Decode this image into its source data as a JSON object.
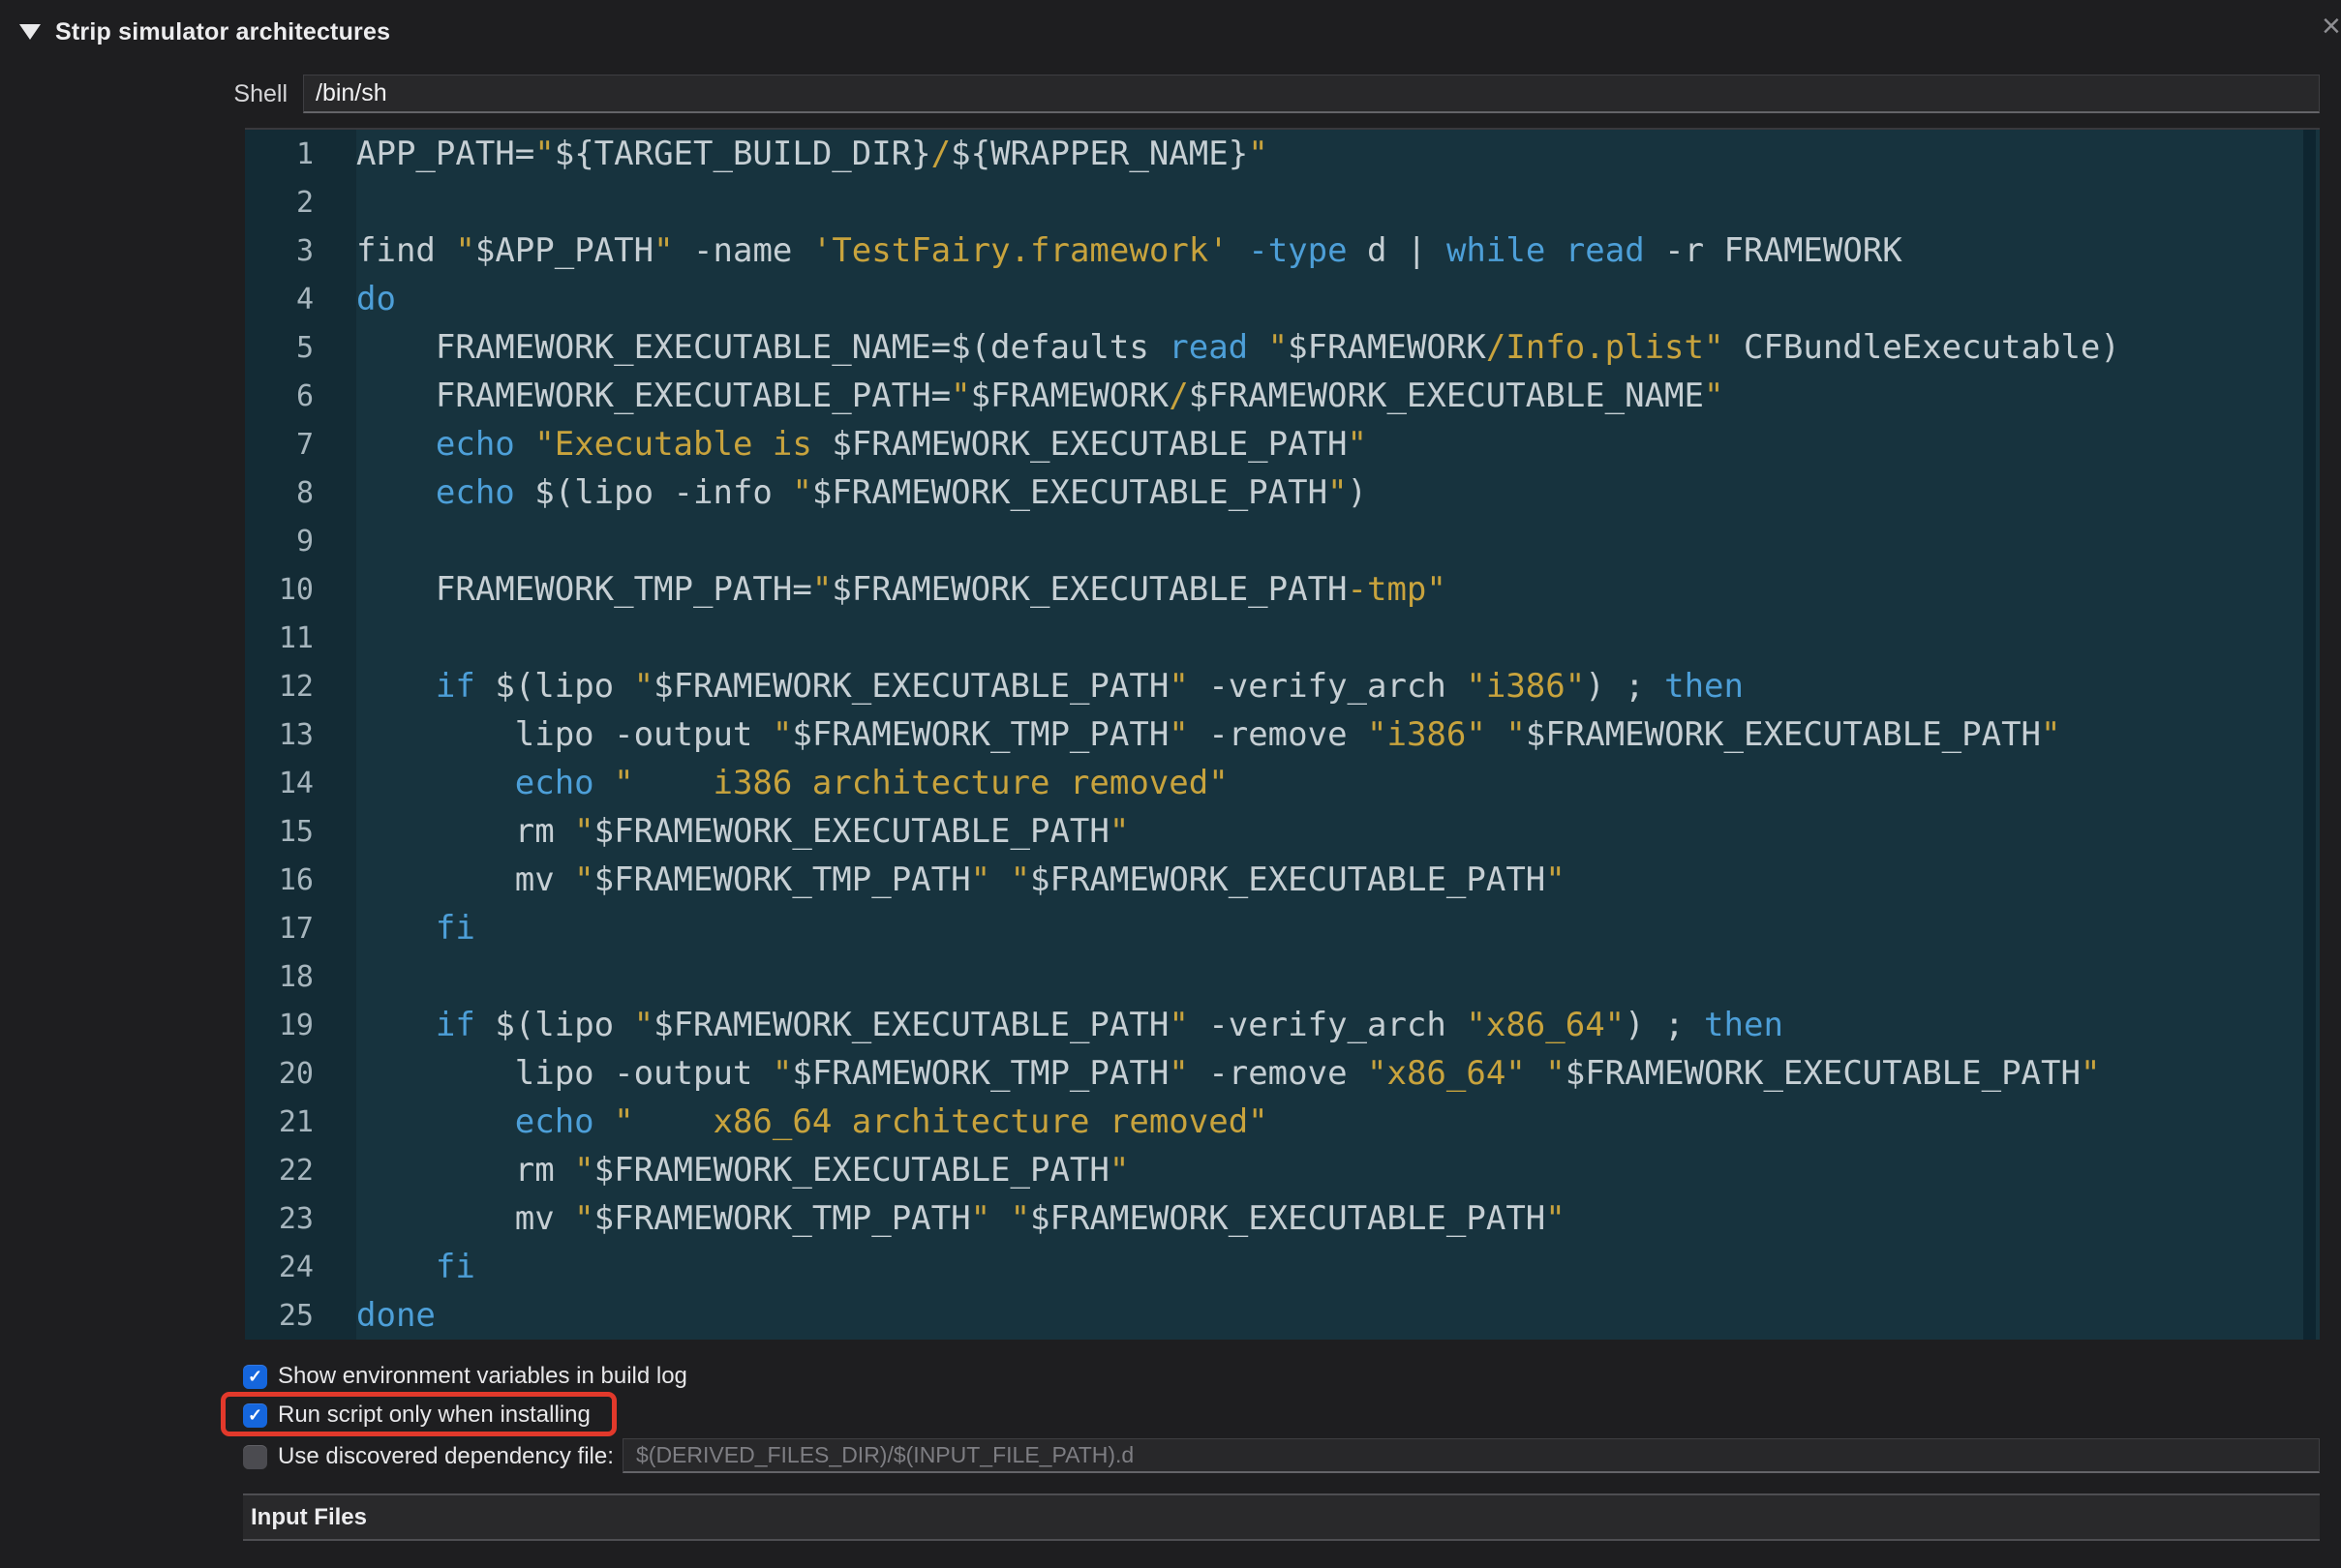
{
  "header": {
    "title": "Strip simulator architectures",
    "disclosure_state": "expanded",
    "close_glyph": "×"
  },
  "shell": {
    "label": "Shell",
    "value": "/bin/sh"
  },
  "editor": {
    "language": "shell-script",
    "line_count": 25,
    "lines": [
      {
        "n": 1,
        "tokens": [
          [
            "p",
            "APP_PATH="
          ],
          [
            "o",
            "\""
          ],
          [
            "p",
            "${TARGET_BUILD_DIR}"
          ],
          [
            "o",
            "/"
          ],
          [
            "p",
            "${WRAPPER_NAME}"
          ],
          [
            "o",
            "\""
          ]
        ]
      },
      {
        "n": 2,
        "tokens": []
      },
      {
        "n": 3,
        "tokens": [
          [
            "p",
            "find "
          ],
          [
            "o",
            "\""
          ],
          [
            "p",
            "$APP_PATH"
          ],
          [
            "o",
            "\""
          ],
          [
            "p",
            " -name "
          ],
          [
            "o",
            "'TestFairy.framework'"
          ],
          [
            "p",
            " "
          ],
          [
            "b",
            "-type"
          ],
          [
            "p",
            " d | "
          ],
          [
            "b",
            "while"
          ],
          [
            "p",
            " "
          ],
          [
            "b",
            "read"
          ],
          [
            "p",
            " -r FRAMEWORK"
          ]
        ]
      },
      {
        "n": 4,
        "tokens": [
          [
            "b",
            "do"
          ]
        ]
      },
      {
        "n": 5,
        "tokens": [
          [
            "p",
            "    FRAMEWORK_EXECUTABLE_NAME=$(defaults "
          ],
          [
            "b",
            "read"
          ],
          [
            "p",
            " "
          ],
          [
            "o",
            "\""
          ],
          [
            "p",
            "$FRAMEWORK"
          ],
          [
            "o",
            "/Info.plist\""
          ],
          [
            "p",
            " CFBundleExecutable)"
          ]
        ]
      },
      {
        "n": 6,
        "tokens": [
          [
            "p",
            "    FRAMEWORK_EXECUTABLE_PATH="
          ],
          [
            "o",
            "\""
          ],
          [
            "p",
            "$FRAMEWORK"
          ],
          [
            "o",
            "/"
          ],
          [
            "p",
            "$FRAMEWORK_EXECUTABLE_NAME"
          ],
          [
            "o",
            "\""
          ]
        ]
      },
      {
        "n": 7,
        "tokens": [
          [
            "p",
            "    "
          ],
          [
            "b",
            "echo"
          ],
          [
            "p",
            " "
          ],
          [
            "o",
            "\"Executable is "
          ],
          [
            "p",
            "$FRAMEWORK_EXECUTABLE_PATH"
          ],
          [
            "o",
            "\""
          ]
        ]
      },
      {
        "n": 8,
        "tokens": [
          [
            "p",
            "    "
          ],
          [
            "b",
            "echo"
          ],
          [
            "p",
            " $(lipo -info "
          ],
          [
            "o",
            "\""
          ],
          [
            "p",
            "$FRAMEWORK_EXECUTABLE_PATH"
          ],
          [
            "o",
            "\""
          ],
          [
            "p",
            ")"
          ]
        ]
      },
      {
        "n": 9,
        "tokens": []
      },
      {
        "n": 10,
        "tokens": [
          [
            "p",
            "    FRAMEWORK_TMP_PATH="
          ],
          [
            "o",
            "\""
          ],
          [
            "p",
            "$FRAMEWORK_EXECUTABLE_PATH"
          ],
          [
            "o",
            "-tmp\""
          ]
        ]
      },
      {
        "n": 11,
        "tokens": []
      },
      {
        "n": 12,
        "tokens": [
          [
            "p",
            "    "
          ],
          [
            "b",
            "if"
          ],
          [
            "p",
            " $(lipo "
          ],
          [
            "o",
            "\""
          ],
          [
            "p",
            "$FRAMEWORK_EXECUTABLE_PATH"
          ],
          [
            "o",
            "\""
          ],
          [
            "p",
            " -verify_arch "
          ],
          [
            "o",
            "\"i386\""
          ],
          [
            "p",
            ") ; "
          ],
          [
            "b",
            "then"
          ]
        ]
      },
      {
        "n": 13,
        "tokens": [
          [
            "p",
            "        lipo -output "
          ],
          [
            "o",
            "\""
          ],
          [
            "p",
            "$FRAMEWORK_TMP_PATH"
          ],
          [
            "o",
            "\""
          ],
          [
            "p",
            " -remove "
          ],
          [
            "o",
            "\"i386\""
          ],
          [
            "p",
            " "
          ],
          [
            "o",
            "\""
          ],
          [
            "p",
            "$FRAMEWORK_EXECUTABLE_PATH"
          ],
          [
            "o",
            "\""
          ]
        ]
      },
      {
        "n": 14,
        "tokens": [
          [
            "p",
            "        "
          ],
          [
            "b",
            "echo"
          ],
          [
            "p",
            " "
          ],
          [
            "o",
            "\"    i386 architecture removed\""
          ]
        ]
      },
      {
        "n": 15,
        "tokens": [
          [
            "p",
            "        rm "
          ],
          [
            "o",
            "\""
          ],
          [
            "p",
            "$FRAMEWORK_EXECUTABLE_PATH"
          ],
          [
            "o",
            "\""
          ]
        ]
      },
      {
        "n": 16,
        "tokens": [
          [
            "p",
            "        mv "
          ],
          [
            "o",
            "\""
          ],
          [
            "p",
            "$FRAMEWORK_TMP_PATH"
          ],
          [
            "o",
            "\""
          ],
          [
            "p",
            " "
          ],
          [
            "o",
            "\""
          ],
          [
            "p",
            "$FRAMEWORK_EXECUTABLE_PATH"
          ],
          [
            "o",
            "\""
          ]
        ]
      },
      {
        "n": 17,
        "tokens": [
          [
            "p",
            "    "
          ],
          [
            "b",
            "fi"
          ]
        ]
      },
      {
        "n": 18,
        "tokens": []
      },
      {
        "n": 19,
        "tokens": [
          [
            "p",
            "    "
          ],
          [
            "b",
            "if"
          ],
          [
            "p",
            " $(lipo "
          ],
          [
            "o",
            "\""
          ],
          [
            "p",
            "$FRAMEWORK_EXECUTABLE_PATH"
          ],
          [
            "o",
            "\""
          ],
          [
            "p",
            " -verify_arch "
          ],
          [
            "o",
            "\"x86_64\""
          ],
          [
            "p",
            ") ; "
          ],
          [
            "b",
            "then"
          ]
        ]
      },
      {
        "n": 20,
        "tokens": [
          [
            "p",
            "        lipo -output "
          ],
          [
            "o",
            "\""
          ],
          [
            "p",
            "$FRAMEWORK_TMP_PATH"
          ],
          [
            "o",
            "\""
          ],
          [
            "p",
            " -remove "
          ],
          [
            "o",
            "\"x86_64\""
          ],
          [
            "p",
            " "
          ],
          [
            "o",
            "\""
          ],
          [
            "p",
            "$FRAMEWORK_EXECUTABLE_PATH"
          ],
          [
            "o",
            "\""
          ]
        ]
      },
      {
        "n": 21,
        "tokens": [
          [
            "p",
            "        "
          ],
          [
            "b",
            "echo"
          ],
          [
            "p",
            " "
          ],
          [
            "o",
            "\"    x86_64 architecture removed\""
          ]
        ]
      },
      {
        "n": 22,
        "tokens": [
          [
            "p",
            "        rm "
          ],
          [
            "o",
            "\""
          ],
          [
            "p",
            "$FRAMEWORK_EXECUTABLE_PATH"
          ],
          [
            "o",
            "\""
          ]
        ]
      },
      {
        "n": 23,
        "tokens": [
          [
            "p",
            "        mv "
          ],
          [
            "o",
            "\""
          ],
          [
            "p",
            "$FRAMEWORK_TMP_PATH"
          ],
          [
            "o",
            "\""
          ],
          [
            "p",
            " "
          ],
          [
            "o",
            "\""
          ],
          [
            "p",
            "$FRAMEWORK_EXECUTABLE_PATH"
          ],
          [
            "o",
            "\""
          ]
        ]
      },
      {
        "n": 24,
        "tokens": [
          [
            "p",
            "    "
          ],
          [
            "b",
            "fi"
          ]
        ]
      },
      {
        "n": 25,
        "tokens": [
          [
            "b",
            "done"
          ]
        ]
      }
    ]
  },
  "options": {
    "check_glyph": "✓",
    "items": [
      {
        "label": "Show environment variables in build log",
        "checked": true,
        "highlighted": false
      },
      {
        "label": "Run script only when installing",
        "checked": true,
        "highlighted": true
      },
      {
        "label": "Use discovered dependency file:",
        "checked": false,
        "highlighted": false,
        "field_placeholder": "$(DERIVED_FILES_DIR)/$(INPUT_FILE_PATH).d"
      }
    ]
  },
  "sections": {
    "input_files": "Input Files"
  },
  "colors": {
    "page_bg": "#1e1e20",
    "editor_bg": "#17333e",
    "gutter_bg": "#132b35",
    "code_plain": "#c6cfd4",
    "code_keyword": "#4d9fd8",
    "code_string": "#c8a33d",
    "line_num": "#a6b5bd",
    "checkbox_blue": "#1566dd",
    "annotation_red": "#e2392b"
  }
}
